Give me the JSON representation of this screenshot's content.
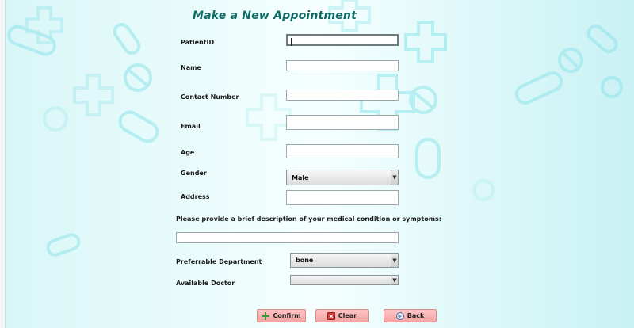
{
  "title": "Make a New Appointment",
  "form": {
    "patient_id": {
      "label": "PatientID",
      "value": ""
    },
    "name": {
      "label": "Name",
      "value": ""
    },
    "contact": {
      "label": "Contact  Number",
      "value": ""
    },
    "email": {
      "label": "Email",
      "value": ""
    },
    "age": {
      "label": "Age",
      "value": ""
    },
    "gender": {
      "label": "Gender",
      "selected": "Male"
    },
    "address": {
      "label": "Address",
      "value": ""
    },
    "description": {
      "label": "Please provide a brief description of your medical condition or symptoms:",
      "value": ""
    },
    "department": {
      "label": "Preferrable  Department",
      "selected": "bone"
    },
    "doctor": {
      "label": "Available Doctor",
      "selected": ""
    }
  },
  "buttons": {
    "confirm": {
      "label": "Confirm",
      "icon": "plus-icon"
    },
    "clear": {
      "label": "Clear",
      "icon": "clear-icon"
    },
    "back": {
      "label": "Back",
      "icon": "back-icon"
    }
  },
  "colors": {
    "title": "#0e6a66",
    "button": "#f5a4a4",
    "decor": "#8fe3ea"
  }
}
